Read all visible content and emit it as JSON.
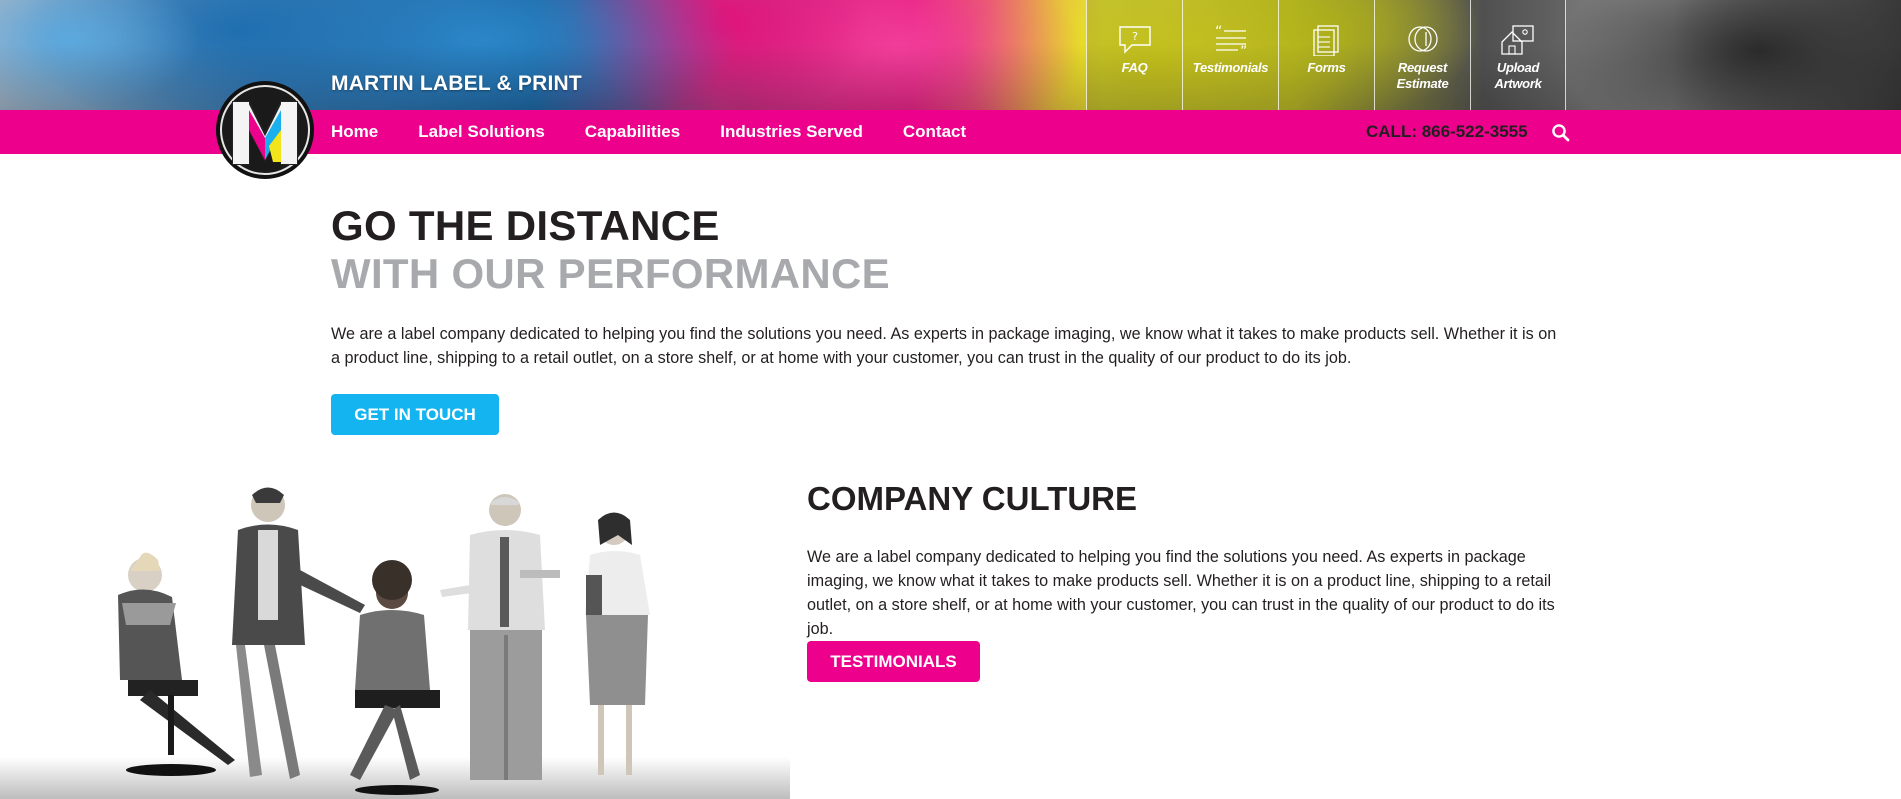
{
  "header": {
    "brand_name": "MARTIN LABEL & PRINT",
    "quick_links": [
      {
        "label": "FAQ",
        "icon": "faq-bubble-icon"
      },
      {
        "label": "Testimonials",
        "icon": "quote-icon"
      },
      {
        "label": "Forms",
        "icon": "forms-icon"
      },
      {
        "label": "Request Estimate",
        "icon": "estimate-coin-icon"
      },
      {
        "label": "Upload Artwork",
        "icon": "upload-artwork-icon"
      }
    ]
  },
  "nav": {
    "items": [
      "Home",
      "Label Solutions",
      "Capabilities",
      "Industries Served",
      "Contact"
    ],
    "call": "CALL: 866-522-3555",
    "search_icon": "search-icon"
  },
  "hero": {
    "heading_line1": "GO THE DISTANCE",
    "heading_line2": "WITH OUR PERFORMANCE",
    "body": "We are a label company dedicated to helping you find the solutions you need. As experts in package imaging, we know what it takes to make products sell. Whether it is on a product line, shipping to a retail outlet, on a store shelf, or at home with your customer, you can trust in the quality of our product to do its job.",
    "button": "GET IN TOUCH"
  },
  "culture": {
    "heading": "COMPANY CULTURE",
    "body": "We are a label company dedicated to helping you find the solutions you need. As experts in package imaging, we know what it takes to make products sell. Whether it is on a product line, shipping to a retail outlet, on a store shelf, or at home with your customer, you can trust in the quality of our product to do its job.",
    "button": "TESTIMONIALS"
  },
  "colors": {
    "brand_pink": "#ec008c",
    "brand_blue": "#14b4f0",
    "heading_dark": "#231f20",
    "heading_gray": "#a7a9ac"
  }
}
